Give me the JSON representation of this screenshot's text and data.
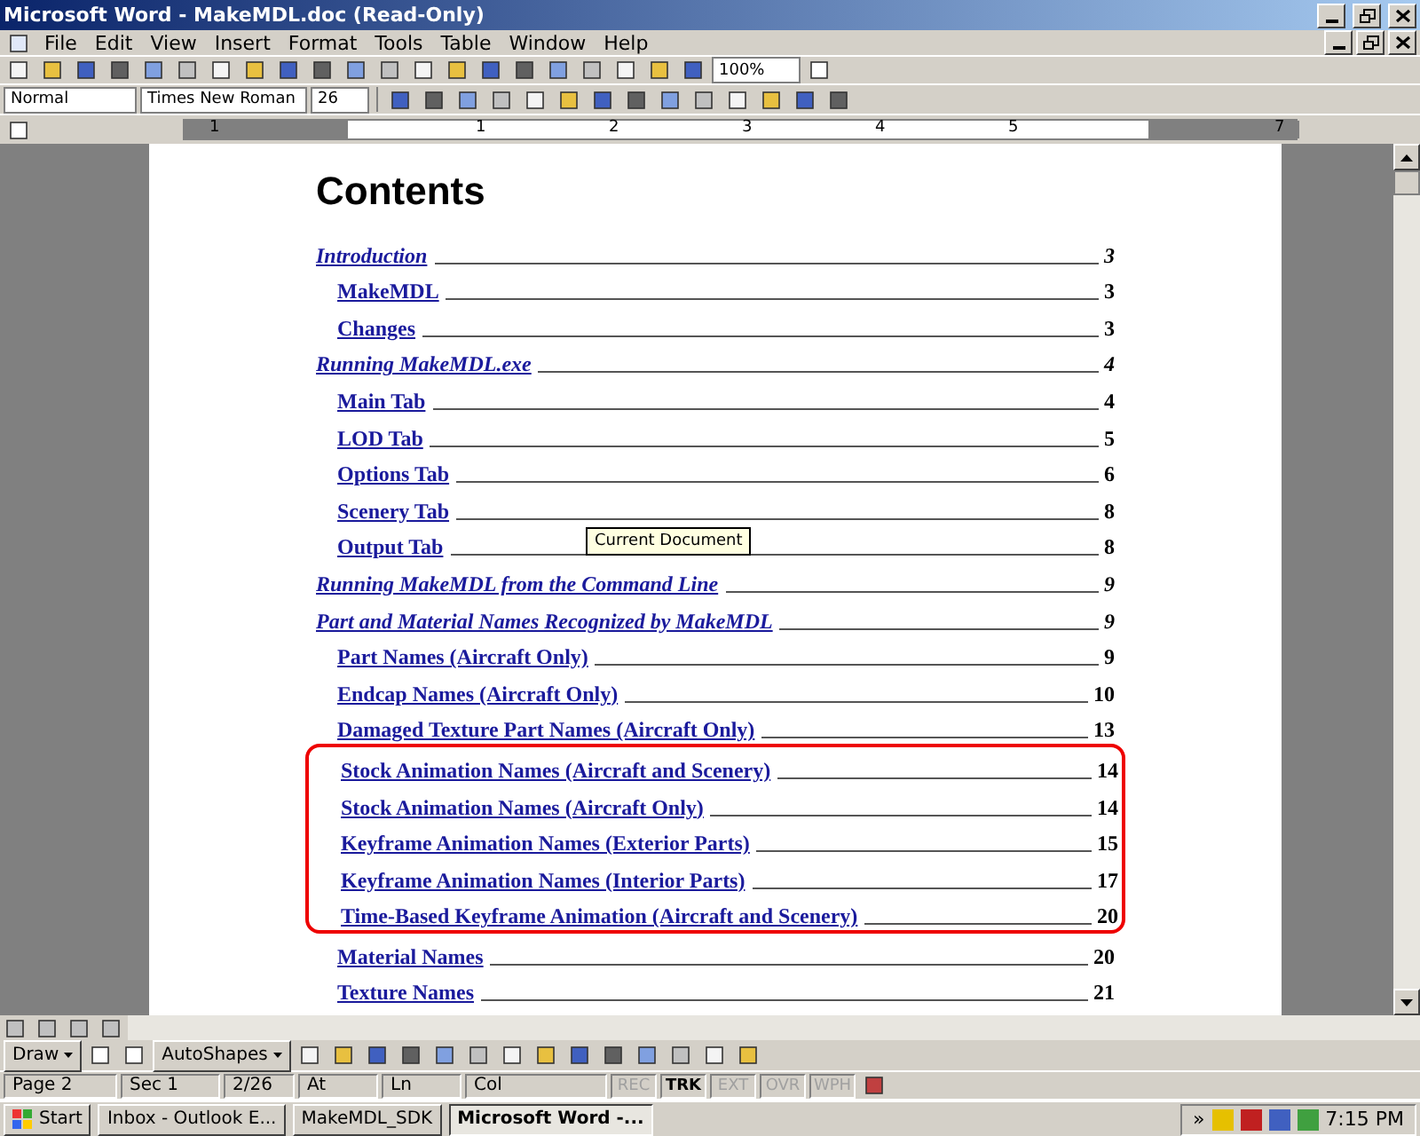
{
  "window": {
    "title": "Microsoft Word - MakeMDL.doc (Read-Only)"
  },
  "menu": [
    "File",
    "Edit",
    "View",
    "Insert",
    "Format",
    "Tools",
    "Table",
    "Window",
    "Help"
  ],
  "standard_toolbar": {
    "zoom": "100%"
  },
  "formatting_toolbar": {
    "style": "Normal",
    "font": "Times New Roman",
    "size": "26"
  },
  "ruler": [
    "1",
    "1",
    "2",
    "3",
    "4",
    "5",
    "7"
  ],
  "document": {
    "heading": "Contents",
    "toc": [
      {
        "title": "Introduction",
        "page": "3",
        "children": [
          {
            "title": "MakeMDL",
            "page": "3",
            "circled": false
          },
          {
            "title": "Changes",
            "page": "3",
            "circled": false
          }
        ]
      },
      {
        "title": "Running MakeMDL.exe",
        "page": "4",
        "children": [
          {
            "title": "Main Tab",
            "page": "4",
            "circled": false
          },
          {
            "title": "LOD Tab",
            "page": "5",
            "circled": false
          },
          {
            "title": "Options Tab",
            "page": "6",
            "circled": false
          },
          {
            "title": "Scenery Tab",
            "page": "8",
            "circled": false
          },
          {
            "title": "Output Tab",
            "page": "8",
            "circled": false
          }
        ]
      },
      {
        "title": "Running MakeMDL from the Command Line",
        "page": "9"
      },
      {
        "title": "Part and Material Names Recognized by MakeMDL",
        "page": "9",
        "children": [
          {
            "title": "Part Names (Aircraft Only)",
            "page": "9",
            "circled": false
          },
          {
            "title": "Endcap Names (Aircraft Only)",
            "page": "10",
            "circled": false
          },
          {
            "title": "Damaged Texture Part Names (Aircraft Only)",
            "page": "13",
            "circled": false
          },
          {
            "title": "Stock Animation Names (Aircraft and Scenery)",
            "page": "14",
            "circled": true
          },
          {
            "title": "Stock Animation Names (Aircraft Only)",
            "page": "14",
            "circled": true
          },
          {
            "title": "Keyframe Animation Names (Exterior Parts)",
            "page": "15",
            "circled": true
          },
          {
            "title": "Keyframe Animation Names (Interior Parts)",
            "page": "17",
            "circled": true
          },
          {
            "title": "Time-Based Keyframe Animation (Aircraft and Scenery)",
            "page": "20",
            "circled": true
          },
          {
            "title": "Material Names",
            "page": "20",
            "circled": false
          },
          {
            "title": "Texture Names",
            "page": "21",
            "circled": false
          }
        ]
      }
    ],
    "tooltip": "Current Document"
  },
  "drawing_toolbar": {
    "draw": "Draw",
    "autoshapes": "AutoShapes"
  },
  "status_bar": {
    "fields": [
      {
        "text": "Page 2"
      },
      {
        "text": "Sec 1"
      },
      {
        "text": "2/26"
      },
      {
        "text": "At"
      },
      {
        "text": "Ln"
      },
      {
        "text": "Col"
      }
    ],
    "modes": [
      {
        "text": "REC",
        "disabled": true
      },
      {
        "text": "TRK",
        "disabled": false
      },
      {
        "text": "EXT",
        "disabled": true
      },
      {
        "text": "OVR",
        "disabled": true
      },
      {
        "text": "WPH",
        "disabled": true
      }
    ]
  },
  "taskbar": {
    "start": "Start",
    "tasks": [
      {
        "label": "Inbox - Outlook E...",
        "selected": false
      },
      {
        "label": "MakeMDL_SDK",
        "selected": false
      },
      {
        "label": "Microsoft Word -...",
        "selected": true
      }
    ],
    "tray_more": "»",
    "clock": "7:15 PM"
  }
}
